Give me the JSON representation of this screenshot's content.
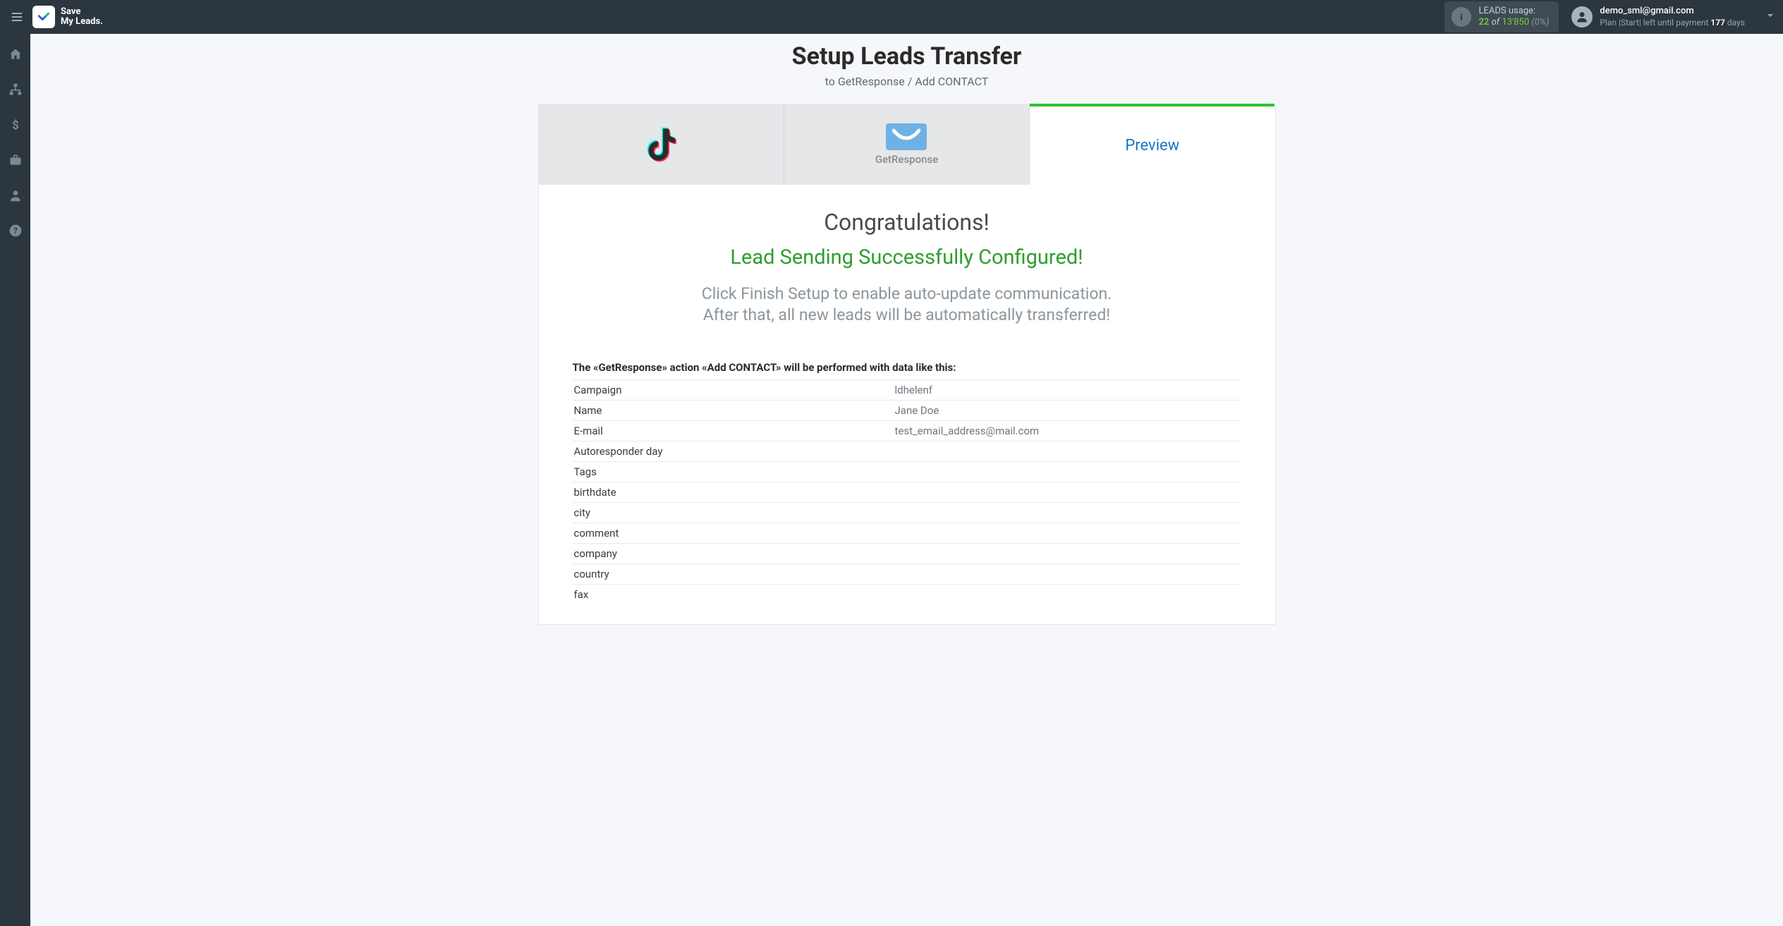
{
  "brand": {
    "line1": "Save",
    "line2": "My Leads."
  },
  "usage": {
    "label": "LEADS usage:",
    "used": "22",
    "of": "of",
    "total": "13'850",
    "pct": "(0%)"
  },
  "user": {
    "email": "demo_sml@gmail.com",
    "plan_prefix": "Plan |Start| left until payment ",
    "days": "177",
    "days_suffix": " days"
  },
  "page": {
    "title": "Setup Leads Transfer",
    "subtitle": "to GetResponse / Add CONTACT"
  },
  "tabs": {
    "source_name": "TikTok",
    "dest_name": "GetResponse",
    "preview": "Preview"
  },
  "messages": {
    "congrats": "Congratulations!",
    "success": "Lead Sending Successfully Configured!",
    "instruct1": "Click Finish Setup to enable auto-update communication.",
    "instruct2": "After that, all new leads will be automatically transferred!",
    "data_intro": "The «GetResponse» action «Add CONTACT» will be performed with data like this:"
  },
  "preview_rows": [
    {
      "key": "Campaign",
      "val": "ldhelenf"
    },
    {
      "key": "Name",
      "val": "Jane Doe"
    },
    {
      "key": "E-mail",
      "val": "test_email_address@mail.com"
    },
    {
      "key": "Autoresponder day",
      "val": ""
    },
    {
      "key": "Tags",
      "val": ""
    },
    {
      "key": "birthdate",
      "val": ""
    },
    {
      "key": "city",
      "val": ""
    },
    {
      "key": "comment",
      "val": ""
    },
    {
      "key": "company",
      "val": ""
    },
    {
      "key": "country",
      "val": ""
    },
    {
      "key": "fax",
      "val": ""
    }
  ]
}
